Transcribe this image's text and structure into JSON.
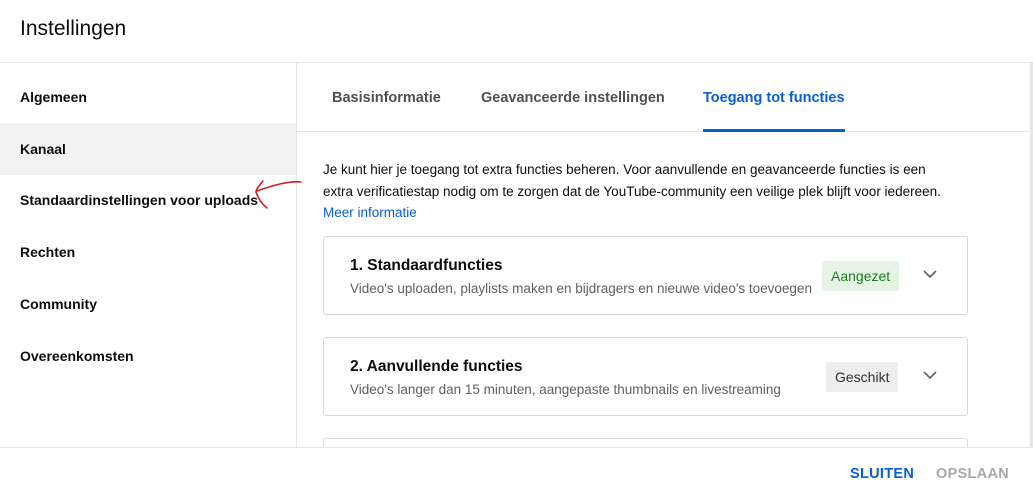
{
  "dialog": {
    "title": "Instellingen"
  },
  "sidebar": {
    "items": [
      {
        "label": "Algemeen"
      },
      {
        "label": "Kanaal"
      },
      {
        "label": "Standaardinstellingen voor uploads"
      },
      {
        "label": "Rechten"
      },
      {
        "label": "Community"
      },
      {
        "label": "Overeenkomsten"
      }
    ],
    "active_index": 1
  },
  "tabs": [
    {
      "label": "Basisinformatie"
    },
    {
      "label": "Geavanceerde instellingen"
    },
    {
      "label": "Toegang tot functies"
    }
  ],
  "content": {
    "intro_line1": "Je kunt hier je toegang tot extra functies beheren. Voor aanvullende en geavanceerde functies is een",
    "intro_line2": "extra verificatiestap nodig om te zorgen dat de YouTube-community een veilige plek blijft voor iedereen.",
    "more_info_link": "Meer informatie",
    "cards": [
      {
        "title": "1. Standaardfuncties",
        "description": "Video's uploaden, playlists maken en bijdragers en nieuwe video's toevoegen",
        "badge": "Aangezet"
      },
      {
        "title": "2. Aanvullende functies",
        "description": "Video's langer dan 15 minuten, aangepaste thumbnails en livestreaming",
        "badge": "Geschikt"
      }
    ]
  },
  "footer": {
    "close_label": "SLUITEN",
    "save_label": "OPSLAAN"
  },
  "colors": {
    "accent": "#065fd4",
    "enabled_badge_bg": "#e6f4e6",
    "enabled_badge_text": "#1e7b1e",
    "eligible_badge_bg": "#eeeeee",
    "annotation_arrow": "#d42020"
  },
  "icons": {
    "card_expand": "chevron-down-icon",
    "annotation": "hand-drawn-arrow-icon"
  }
}
